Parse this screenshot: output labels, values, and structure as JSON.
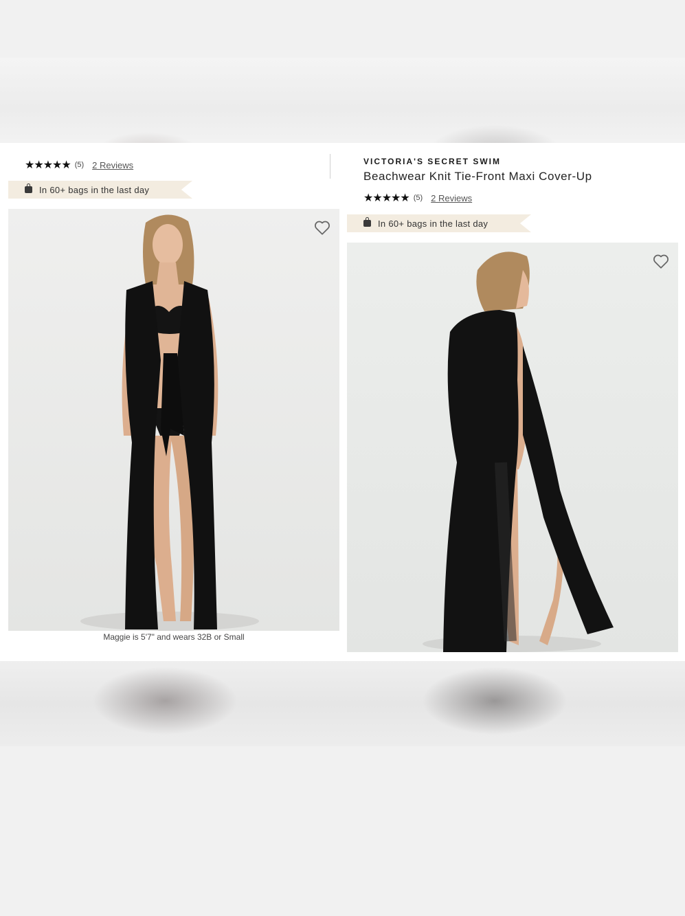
{
  "left": {
    "stars": "★★★★★",
    "review_count": "(5)",
    "reviews_link": "2 Reviews",
    "bag_banner": "In 60+ bags in the last day",
    "caption": "Maggie is 5'7\" and wears 32B or Small",
    "photo_icon": "model-front-photo",
    "heart_icon": "heart-icon"
  },
  "right": {
    "brand": "VICTORIA'S SECRET SWIM",
    "title": "Beachwear Knit Tie-Front Maxi Cover-Up",
    "stars": "★★★★★",
    "review_count": "(5)",
    "reviews_link": "2 Reviews",
    "bag_banner": "In 60+ bags in the last day",
    "photo_icon": "model-back-photo",
    "heart_icon": "heart-icon"
  },
  "colors": {
    "photo_bg": "#ecedec",
    "banner_bg": "#f3ece0",
    "garment": "#111111",
    "skin": "#e0b596"
  }
}
